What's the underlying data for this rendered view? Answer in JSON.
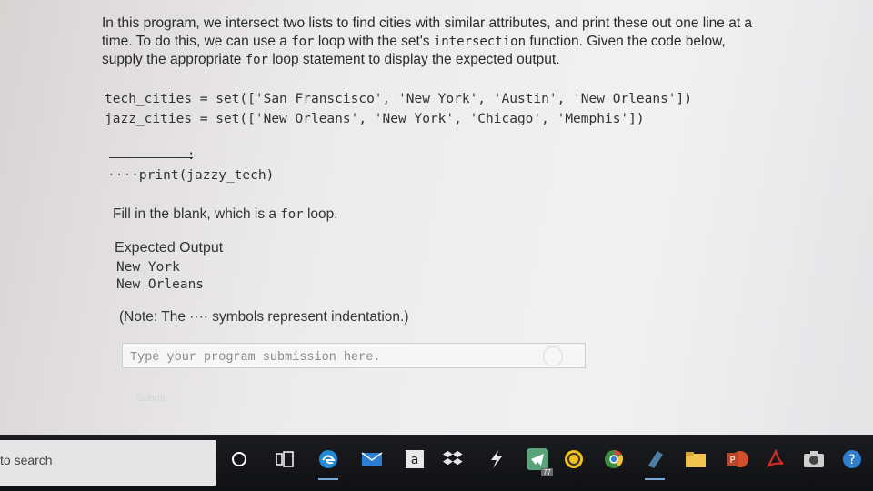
{
  "question": {
    "para_1": "In this program, we intersect two lists to find cities with similar attributes, and print these out one line at a",
    "para_2_pre": "time. To do this, we can use a ",
    "para_2_code1": "for",
    "para_2_mid": " loop with the set's ",
    "para_2_code2": "intersection",
    "para_2_post": " function. Given the code below,",
    "para_3_pre": "supply the appropriate ",
    "para_3_code": "for",
    "para_3_post": " loop statement to display the expected output."
  },
  "code": {
    "line_1": "tech_cities = set(['San Franscisco', 'New York', 'Austin', 'New Orleans'])",
    "line_2": "jazz_cities = set(['New Orleans', 'New York', 'Chicago', 'Memphis'])",
    "colon": ":",
    "indent_dots": "····",
    "line_4": "print(jazzy_tech)"
  },
  "instructions": {
    "fill_pre": "Fill in the blank, which is a ",
    "fill_code": "for",
    "fill_post": " loop.",
    "expected_label": "Expected Output",
    "output_1": "New York",
    "output_2": "New Orleans",
    "note_pre": "(Note: The ",
    "note_dots": "····",
    "note_post": " symbols represent indentation.)"
  },
  "submission": {
    "placeholder": "Type your program submission here.",
    "submit_label": "Submit"
  },
  "taskbar": {
    "search_text": "to search",
    "icons": [
      "cortana-icon",
      "task-view-icon",
      "edge-icon",
      "mail-icon",
      "amazon-icon",
      "dropbox-icon",
      "app-icon",
      "telegram-icon",
      "norton-icon",
      "chrome-icon",
      "notes-icon",
      "file-explorer-icon",
      "powerpoint-icon",
      "acrobat-icon",
      "camera-icon",
      "help-icon"
    ],
    "telegram_badge": "77"
  },
  "colors": {
    "taskbar": "#121317",
    "edge": "#1f8bd6",
    "chrome_green": "#3b8d3e",
    "acrobat": "#e02a24",
    "powerpoint": "#d3502c"
  }
}
